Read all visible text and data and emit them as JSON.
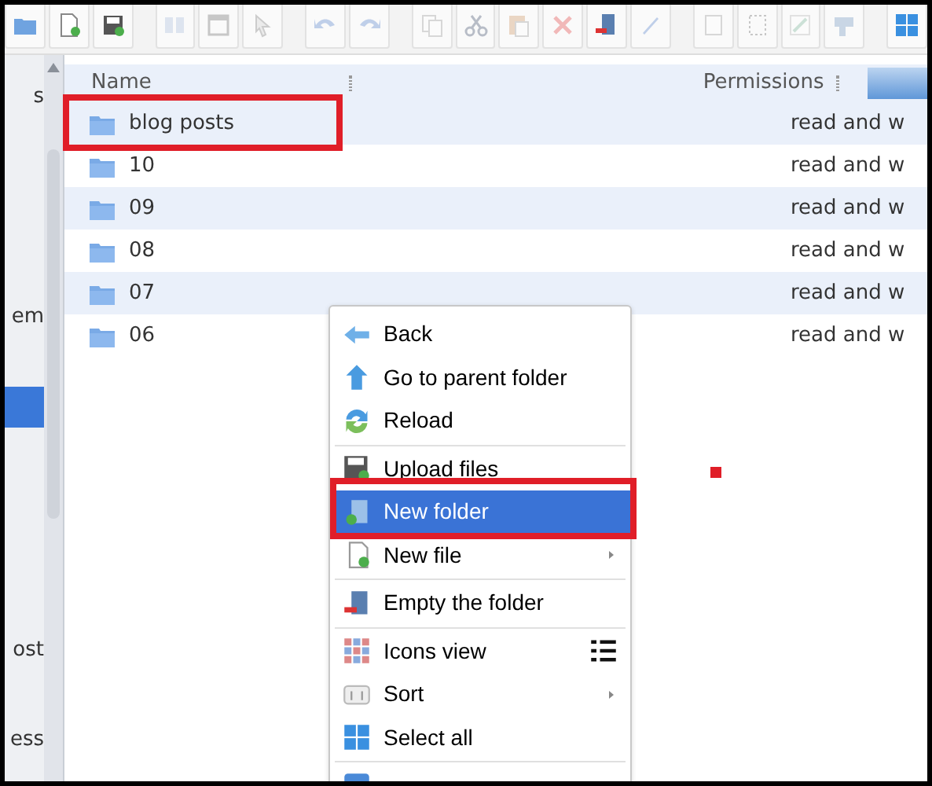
{
  "toolbar": [
    {
      "kind": "folder",
      "disabled": false
    },
    {
      "kind": "new-file",
      "disabled": false
    },
    {
      "kind": "save",
      "disabled": false
    },
    {
      "kind": "open",
      "disabled": true
    },
    {
      "kind": "window",
      "disabled": true
    },
    {
      "kind": "pointer",
      "disabled": true
    },
    {
      "kind": "undo",
      "disabled": true
    },
    {
      "kind": "redo",
      "disabled": true
    },
    {
      "kind": "copy",
      "disabled": true
    },
    {
      "kind": "cut",
      "disabled": true
    },
    {
      "kind": "paste",
      "disabled": true
    },
    {
      "kind": "delete",
      "disabled": true
    },
    {
      "kind": "empty",
      "disabled": false
    },
    {
      "kind": "edit",
      "disabled": true
    },
    {
      "kind": "duplicate",
      "disabled": true
    },
    {
      "kind": "resize",
      "disabled": true
    },
    {
      "kind": "rename",
      "disabled": true
    },
    {
      "kind": "extract",
      "disabled": true
    },
    {
      "kind": "grid",
      "disabled": false
    }
  ],
  "sidebar": {
    "items": [
      {
        "label": "s",
        "selected": false
      },
      {
        "label": "em",
        "selected": false
      },
      {
        "selected": true
      },
      {
        "label": "ost",
        "selected": false
      },
      {
        "label": "ess",
        "selected": false
      }
    ]
  },
  "table": {
    "columns": [
      "Name",
      "Permissions"
    ],
    "rows": [
      {
        "name": "blog posts",
        "permissions": "read and w",
        "highlighted": true
      },
      {
        "name": "10",
        "permissions": "read and w",
        "highlighted": false
      },
      {
        "name": "09",
        "permissions": "read and w",
        "highlighted": false
      },
      {
        "name": "08",
        "permissions": "read and w",
        "highlighted": false
      },
      {
        "name": "07",
        "permissions": "read and w",
        "highlighted": false
      },
      {
        "name": "06",
        "permissions": "read and w",
        "highlighted": false
      }
    ]
  },
  "context_menu": {
    "items": [
      {
        "kind": "back",
        "label": "Back",
        "selected": false
      },
      {
        "kind": "parent",
        "label": "Go to parent folder",
        "selected": false
      },
      {
        "kind": "reload",
        "label": "Reload",
        "selected": false
      },
      {
        "kind": "separator"
      },
      {
        "kind": "upload",
        "label": "Upload files",
        "selected": false
      },
      {
        "kind": "new-folder",
        "label": "New folder",
        "selected": true,
        "highlighted": true
      },
      {
        "kind": "new-file",
        "label": "New file",
        "selected": false,
        "submenu": true
      },
      {
        "kind": "separator"
      },
      {
        "kind": "empty",
        "label": "Empty the folder",
        "selected": false
      },
      {
        "kind": "separator"
      },
      {
        "kind": "icons",
        "label": "Icons view",
        "selected": false,
        "list_toggle": true
      },
      {
        "kind": "sort",
        "label": "Sort",
        "selected": false,
        "submenu": true
      },
      {
        "kind": "select-all",
        "label": "Select all",
        "selected": false
      },
      {
        "kind": "separator"
      },
      {
        "kind": "info",
        "selected": false
      }
    ]
  },
  "marker_dot": true
}
